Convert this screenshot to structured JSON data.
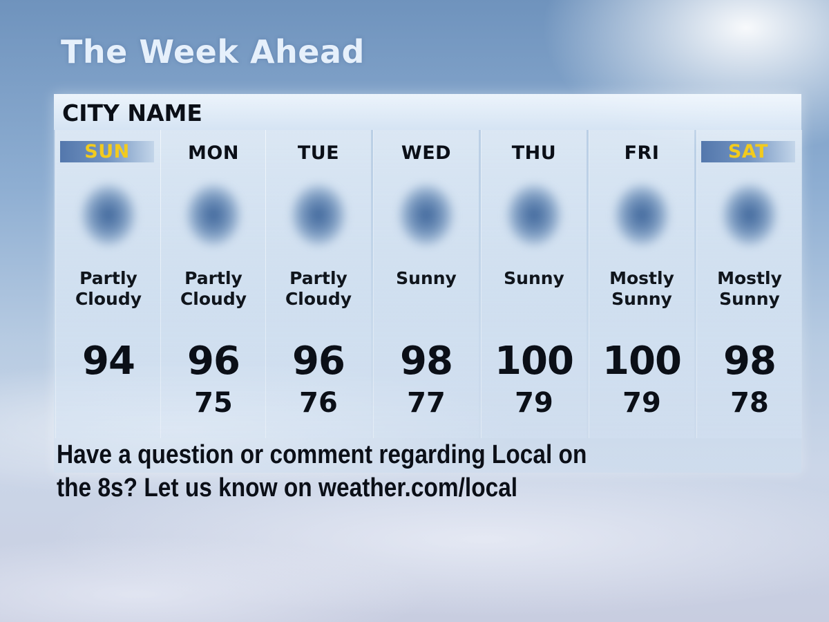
{
  "header": {
    "title": "The Week Ahead"
  },
  "forecast": {
    "city": "CITY NAME",
    "days": [
      {
        "day": "SUN",
        "line1": "Partly",
        "line2": "Cloudy",
        "high": "94",
        "low": ""
      },
      {
        "day": "MON",
        "line1": "Partly",
        "line2": "Cloudy",
        "high": "96",
        "low": "75"
      },
      {
        "day": "TUE",
        "line1": "Partly",
        "line2": "Cloudy",
        "high": "96",
        "low": "76"
      },
      {
        "day": "WED",
        "line1": "Sunny",
        "line2": "",
        "high": "98",
        "low": "77"
      },
      {
        "day": "THU",
        "line1": "Sunny",
        "line2": "",
        "high": "100",
        "low": "79"
      },
      {
        "day": "FRI",
        "line1": "Mostly",
        "line2": "Sunny",
        "high": "100",
        "low": "79"
      },
      {
        "day": "SAT",
        "line1": "Mostly",
        "line2": "Sunny",
        "high": "98",
        "low": "78"
      }
    ]
  },
  "footer": {
    "line1": "Have a question or comment regarding Local on",
    "line2": "the 8s? Let us know on weather.com/local"
  },
  "colors": {
    "weekend_day": "#f2cb1d",
    "text": "#0b0f17",
    "title": "#e6f0fb"
  },
  "icons": [
    "weather-icon"
  ]
}
